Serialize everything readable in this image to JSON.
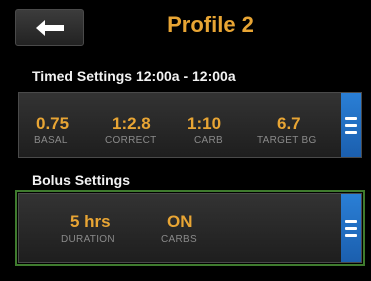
{
  "header": {
    "title": "Profile 2",
    "back_icon": "arrow-left-icon"
  },
  "timed": {
    "heading": "Timed Settings 12:00a - 12:00a",
    "items": [
      {
        "value": "0.75",
        "label": "BASAL"
      },
      {
        "value": "1:2.8",
        "label": "CORRECT"
      },
      {
        "value": "1:10",
        "label": "CARB"
      },
      {
        "value": "6.7",
        "label": "TARGET BG"
      }
    ]
  },
  "bolus": {
    "heading": "Bolus Settings",
    "items": [
      {
        "value": "5 hrs",
        "label": "DURATION"
      },
      {
        "value": "ON",
        "label": "CARBS"
      }
    ]
  },
  "colors": {
    "accent": "#e8a534",
    "menu": "#2a7fd6",
    "selected_outline": "#3f7b2e"
  }
}
